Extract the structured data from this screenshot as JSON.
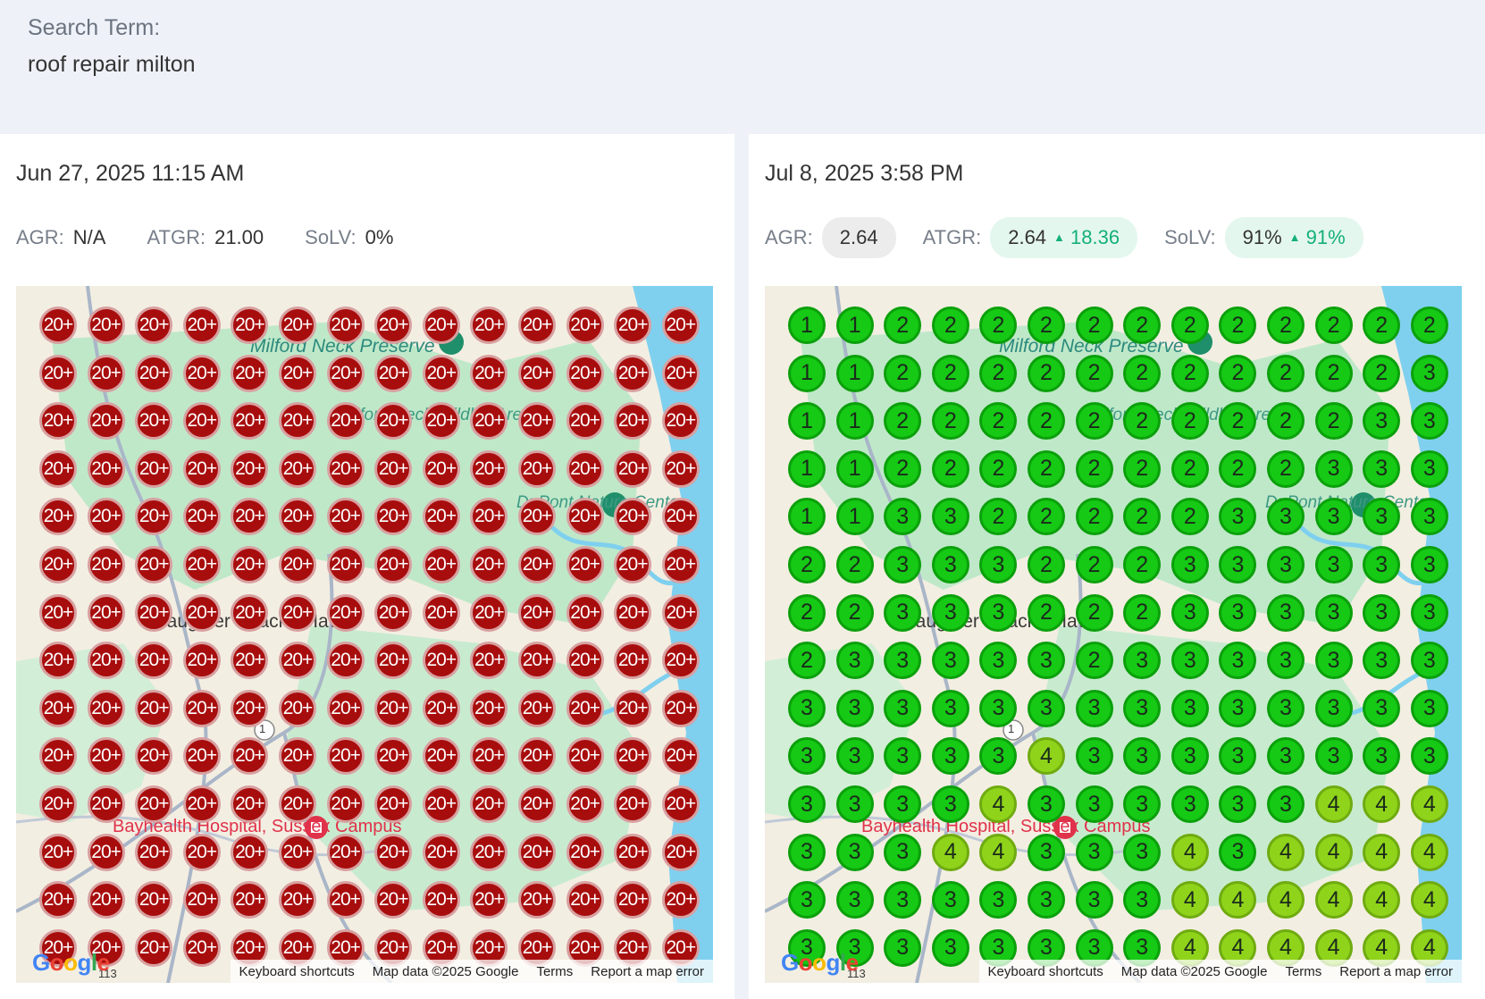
{
  "search": {
    "label": "Search Term:",
    "value": "roof repair milton"
  },
  "map_labels": {
    "preserve": "Milford Neck Preserve",
    "wildlife": "Milford Neck Wildlife Area",
    "dupont": "DuPont Nature Center",
    "hospital": "Bayhealth Hospital, Sussex Campus",
    "town_haven": "Slaughter Beach / Haven",
    "route_1": "1",
    "route_113": "113"
  },
  "map_footer": {
    "keyboard": "Keyboard shortcuts",
    "mapdata": "Map data ©2025 Google",
    "terms": "Terms",
    "report": "Report a map error"
  },
  "google_logo": [
    "G",
    "o",
    "o",
    "g",
    "l",
    "e"
  ],
  "left": {
    "date": "Jun 27, 2025 11:15 AM",
    "agr_label": "AGR:",
    "agr_value": "N/A",
    "atgr_label": "ATGR:",
    "atgr_value": "21.00",
    "solv_label": "SoLV:",
    "solv_value": "0%",
    "grid": [
      [
        "20+",
        "20+",
        "20+",
        "20+",
        "20+",
        "20+",
        "20+",
        "20+",
        "20+",
        "20+",
        "20+",
        "20+",
        "20+",
        "20+"
      ],
      [
        "20+",
        "20+",
        "20+",
        "20+",
        "20+",
        "20+",
        "20+",
        "20+",
        "20+",
        "20+",
        "20+",
        "20+",
        "20+",
        "20+"
      ],
      [
        "20+",
        "20+",
        "20+",
        "20+",
        "20+",
        "20+",
        "20+",
        "20+",
        "20+",
        "20+",
        "20+",
        "20+",
        "20+",
        "20+"
      ],
      [
        "20+",
        "20+",
        "20+",
        "20+",
        "20+",
        "20+",
        "20+",
        "20+",
        "20+",
        "20+",
        "20+",
        "20+",
        "20+",
        "20+"
      ],
      [
        "20+",
        "20+",
        "20+",
        "20+",
        "20+",
        "20+",
        "20+",
        "20+",
        "20+",
        "20+",
        "20+",
        "20+",
        "20+",
        "20+"
      ],
      [
        "20+",
        "20+",
        "20+",
        "20+",
        "20+",
        "20+",
        "20+",
        "20+",
        "20+",
        "20+",
        "20+",
        "20+",
        "20+",
        "20+"
      ],
      [
        "20+",
        "20+",
        "20+",
        "20+",
        "20+",
        "20+",
        "20+",
        "20+",
        "20+",
        "20+",
        "20+",
        "20+",
        "20+",
        "20+"
      ],
      [
        "20+",
        "20+",
        "20+",
        "20+",
        "20+",
        "20+",
        "20+",
        "20+",
        "20+",
        "20+",
        "20+",
        "20+",
        "20+",
        "20+"
      ],
      [
        "20+",
        "20+",
        "20+",
        "20+",
        "20+",
        "20+",
        "20+",
        "20+",
        "20+",
        "20+",
        "20+",
        "20+",
        "20+",
        "20+"
      ],
      [
        "20+",
        "20+",
        "20+",
        "20+",
        "20+",
        "20+",
        "20+",
        "20+",
        "20+",
        "20+",
        "20+",
        "20+",
        "20+",
        "20+"
      ],
      [
        "20+",
        "20+",
        "20+",
        "20+",
        "20+",
        "20+",
        "20+",
        "20+",
        "20+",
        "20+",
        "20+",
        "20+",
        "20+",
        "20+"
      ],
      [
        "20+",
        "20+",
        "20+",
        "20+",
        "20+",
        "20+",
        "20+",
        "20+",
        "20+",
        "20+",
        "20+",
        "20+",
        "20+",
        "20+"
      ],
      [
        "20+",
        "20+",
        "20+",
        "20+",
        "20+",
        "20+",
        "20+",
        "20+",
        "20+",
        "20+",
        "20+",
        "20+",
        "20+",
        "20+"
      ],
      [
        "20+",
        "20+",
        "20+",
        "20+",
        "20+",
        "20+",
        "20+",
        "20+",
        "20+",
        "20+",
        "20+",
        "20+",
        "20+",
        "20+"
      ]
    ]
  },
  "right": {
    "date": "Jul 8, 2025 3:58 PM",
    "agr_label": "AGR:",
    "agr_value": "2.64",
    "atgr_label": "ATGR:",
    "atgr_value": "2.64",
    "atgr_delta": "18.36",
    "solv_label": "SoLV:",
    "solv_value": "91%",
    "solv_delta": "91%",
    "delta_icon": "up-triangle",
    "grid": [
      [
        "1",
        "1",
        "2",
        "2",
        "2",
        "2",
        "2",
        "2",
        "2",
        "2",
        "2",
        "2",
        "2",
        "2"
      ],
      [
        "1",
        "1",
        "2",
        "2",
        "2",
        "2",
        "2",
        "2",
        "2",
        "2",
        "2",
        "2",
        "2",
        "3"
      ],
      [
        "1",
        "1",
        "2",
        "2",
        "2",
        "2",
        "2",
        "2",
        "2",
        "2",
        "2",
        "2",
        "3",
        "3"
      ],
      [
        "1",
        "1",
        "2",
        "2",
        "2",
        "2",
        "2",
        "2",
        "2",
        "2",
        "2",
        "3",
        "3",
        "3"
      ],
      [
        "1",
        "1",
        "3",
        "3",
        "2",
        "2",
        "2",
        "2",
        "2",
        "3",
        "3",
        "3",
        "3",
        "3"
      ],
      [
        "2",
        "2",
        "3",
        "3",
        "3",
        "2",
        "2",
        "2",
        "3",
        "3",
        "3",
        "3",
        "3",
        "3"
      ],
      [
        "2",
        "2",
        "3",
        "3",
        "3",
        "2",
        "2",
        "2",
        "3",
        "3",
        "3",
        "3",
        "3",
        "3"
      ],
      [
        "2",
        "3",
        "3",
        "3",
        "3",
        "3",
        "2",
        "3",
        "3",
        "3",
        "3",
        "3",
        "3",
        "3"
      ],
      [
        "3",
        "3",
        "3",
        "3",
        "3",
        "3",
        "3",
        "3",
        "3",
        "3",
        "3",
        "3",
        "3",
        "3"
      ],
      [
        "3",
        "3",
        "3",
        "3",
        "3",
        "4",
        "3",
        "3",
        "3",
        "3",
        "3",
        "3",
        "3",
        "3"
      ],
      [
        "3",
        "3",
        "3",
        "3",
        "4",
        "3",
        "3",
        "3",
        "3",
        "3",
        "3",
        "4",
        "4",
        "4"
      ],
      [
        "3",
        "3",
        "3",
        "4",
        "4",
        "3",
        "3",
        "3",
        "4",
        "3",
        "4",
        "4",
        "4",
        "4"
      ],
      [
        "3",
        "3",
        "3",
        "3",
        "3",
        "3",
        "3",
        "3",
        "4",
        "4",
        "4",
        "4",
        "4",
        "4"
      ],
      [
        "3",
        "3",
        "3",
        "3",
        "3",
        "3",
        "3",
        "3",
        "4",
        "4",
        "4",
        "4",
        "4",
        "4"
      ]
    ]
  }
}
